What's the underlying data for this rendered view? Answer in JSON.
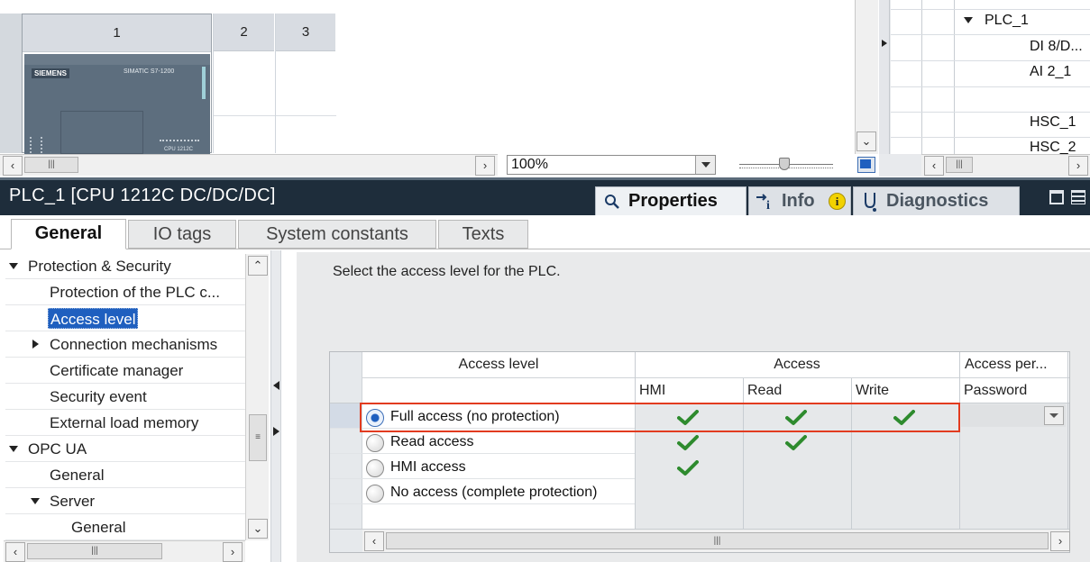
{
  "device_view": {
    "slots": [
      "1",
      "2",
      "3"
    ],
    "device_brand": "SIEMENS",
    "device_model": "SIMATIC S7-1200",
    "device_cpu_label": "CPU 1212C",
    "zoom_value": "100%"
  },
  "network_tree": {
    "items": [
      "PLC_1",
      "DI 8/D...",
      "AI 2_1",
      "",
      "HSC_1",
      "HSC_2"
    ]
  },
  "properties_bar": {
    "title": "PLC_1 [CPU 1212C DC/DC/DC]",
    "tabs": [
      "Properties",
      "Info",
      "Diagnostics"
    ]
  },
  "general_tabs": [
    "General",
    "IO tags",
    "System constants",
    "Texts"
  ],
  "nav_tree": [
    {
      "label": "Protection & Security",
      "expanded": true
    },
    {
      "label": "Protection of the PLC c...",
      "expanded": null
    },
    {
      "label": "Access level",
      "expanded": null,
      "selected": true
    },
    {
      "label": "Connection mechanisms",
      "expanded": false
    },
    {
      "label": "Certificate manager",
      "expanded": null
    },
    {
      "label": "Security event",
      "expanded": null
    },
    {
      "label": "External load memory",
      "expanded": null
    },
    {
      "label": "OPC UA",
      "expanded": true
    },
    {
      "label": "General",
      "expanded": null
    },
    {
      "label": "Server",
      "expanded": true
    },
    {
      "label": "General",
      "expanded": null
    }
  ],
  "content": {
    "instruction": "Select the access level for the PLC.",
    "table": {
      "headers": {
        "access_level": "Access level",
        "access": "Access",
        "access_permission": "Access per...",
        "hmi": "HMI",
        "read": "Read",
        "write": "Write",
        "password": "Password"
      },
      "rows": [
        {
          "label": "Full access (no protection)",
          "selected": true,
          "hmi": true,
          "read": true,
          "write": true
        },
        {
          "label": "Read access",
          "selected": false,
          "hmi": true,
          "read": true,
          "write": false
        },
        {
          "label": "HMI access",
          "selected": false,
          "hmi": true,
          "read": false,
          "write": false
        },
        {
          "label": "No access (complete protection)",
          "selected": false,
          "hmi": false,
          "read": false,
          "write": false
        }
      ]
    }
  },
  "colors": {
    "check_green": "#2e8b2e",
    "highlight_border": "#e23b1f",
    "selection_bg": "#1f5fbf",
    "header_dark": "#1e2d3b"
  }
}
